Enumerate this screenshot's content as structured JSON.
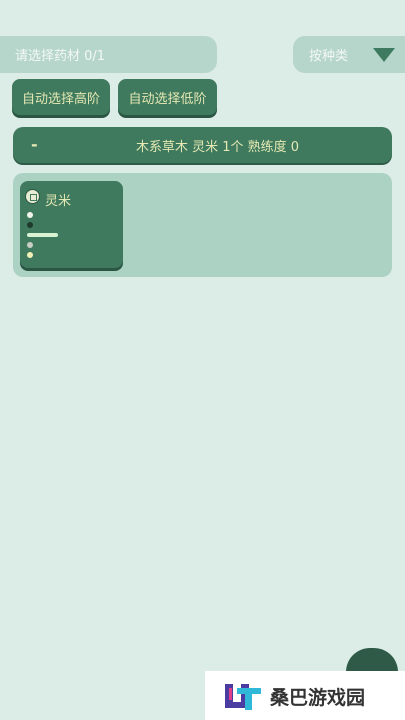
{
  "header": {
    "selection_label": "请选择药材 0/1",
    "sort_label": "按种类",
    "sort_icon": "triangle-down"
  },
  "auto_select": {
    "high_label": "自动选择高阶",
    "low_label": "自动选择低阶"
  },
  "group": {
    "collapse_symbol": "-",
    "title": "木系草木 灵米 1个  熟练度 0"
  },
  "items": [
    {
      "name": "灵米",
      "badge_icon": "grade-badge-icon",
      "progress_fraction": 0.85
    }
  ],
  "watermark": {
    "text": "桑巴游戏园"
  },
  "colors": {
    "background": "#dcece6",
    "pill": "#b7d6cb",
    "button": "#3f7a5f",
    "button_text": "#e4e8b2",
    "panel": "#acd2c4"
  }
}
